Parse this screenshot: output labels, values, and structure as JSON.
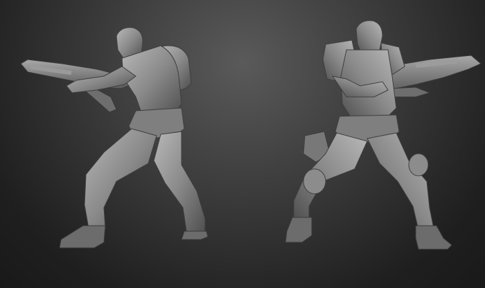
{
  "scene": {
    "colors": {
      "background_center": "#5a5a5a",
      "background_edge": "#191919",
      "clay_light": "#b5b5b5",
      "clay_mid": "#858585",
      "clay_dark": "#4a4a4a"
    },
    "subjects": [
      {
        "name": "soldier-back-view"
      },
      {
        "name": "soldier-front-view"
      }
    ]
  }
}
